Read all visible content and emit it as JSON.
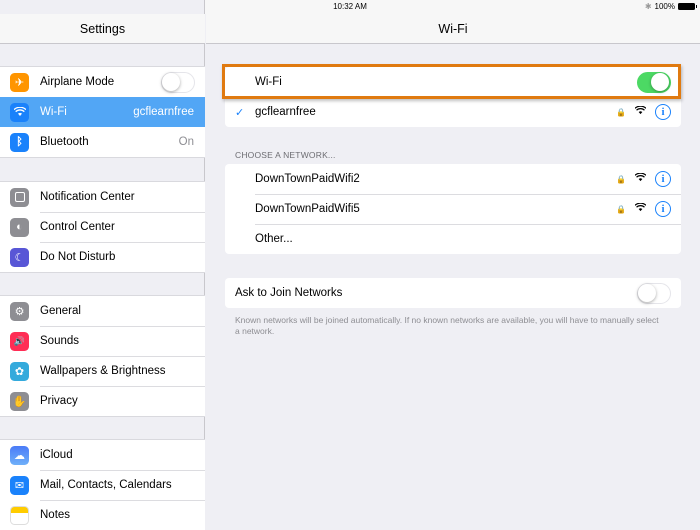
{
  "status_bar": {
    "device": "iPad",
    "time": "10:32 AM",
    "battery": "100%"
  },
  "sidebar": {
    "title": "Settings",
    "groups": [
      [
        {
          "label": "Airplane Mode",
          "icon": "airplane-icon",
          "color": "#ff9500",
          "toggle": false
        },
        {
          "label": "Wi-Fi",
          "icon": "wifi-icon",
          "color": "#1a82fb",
          "value": "gcflearnfree",
          "selected": true
        },
        {
          "label": "Bluetooth",
          "icon": "bluetooth-icon",
          "color": "#1a82fb",
          "value": "On"
        }
      ],
      [
        {
          "label": "Notification Center",
          "icon": "notification-center-icon",
          "color": "#8e8e93"
        },
        {
          "label": "Control Center",
          "icon": "control-center-icon",
          "color": "#8e8e93"
        },
        {
          "label": "Do Not Disturb",
          "icon": "moon-icon",
          "color": "#5856d6"
        }
      ],
      [
        {
          "label": "General",
          "icon": "gear-icon",
          "color": "#8e8e93"
        },
        {
          "label": "Sounds",
          "icon": "speaker-icon",
          "color": "#ff2d55"
        },
        {
          "label": "Wallpapers & Brightness",
          "icon": "wallpaper-icon",
          "color": "#34aadc"
        },
        {
          "label": "Privacy",
          "icon": "hand-icon",
          "color": "#8e8e93"
        }
      ],
      [
        {
          "label": "iCloud",
          "icon": "cloud-icon",
          "color": "#5b8ff9"
        },
        {
          "label": "Mail, Contacts, Calendars",
          "icon": "mail-icon",
          "color": "#1a82fb"
        },
        {
          "label": "Notes",
          "icon": "notes-icon",
          "color": "#ffcc00"
        }
      ]
    ]
  },
  "main": {
    "title": "Wi-Fi",
    "wifi_label": "Wi-Fi",
    "wifi_on": true,
    "connected_network": "gcflearnfree",
    "choose_header": "CHOOSE A NETWORK...",
    "networks": [
      {
        "name": "DownTownPaidWifi2",
        "locked": true
      },
      {
        "name": "DownTownPaidWifi5",
        "locked": true
      }
    ],
    "other_label": "Other...",
    "ask_join_label": "Ask to Join Networks",
    "ask_join_on": false,
    "ask_join_note": "Known networks will be joined automatically. If no known networks are available, you will have to manually select a network."
  },
  "colors": {
    "accent": "#1a82fb",
    "toggle_on": "#4cd964",
    "highlight": "#e07a10",
    "selected_row": "#52a6f5"
  }
}
